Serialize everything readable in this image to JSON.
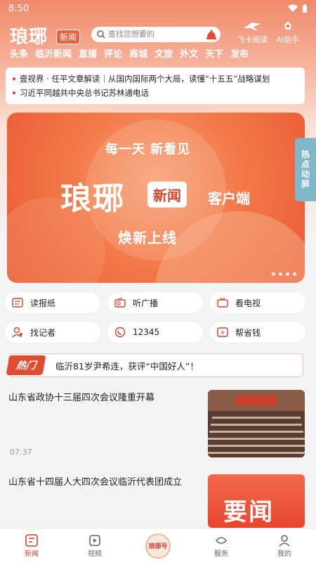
{
  "status": {
    "time": "8:50"
  },
  "header": {
    "logo": "琅琊",
    "logo_badge": "新闻",
    "search_placeholder": "查找您想要的",
    "right_items": [
      {
        "label": "飞卡阅读",
        "icon": "bird-icon"
      },
      {
        "label": "AI助手",
        "icon": "ai-assistant-icon"
      }
    ]
  },
  "channels": [
    "头条",
    "临沂新闻",
    "直播",
    "评论",
    "商城",
    "文旅",
    "外文",
    "天下",
    "发布"
  ],
  "top_news": [
    "壹视界 · 任平文章解读｜从国内国际两个大局，读懂“十五五”战略谋划",
    "习近平同越共中央总书记苏林通电话"
  ],
  "banner": {
    "subtitle": "每一天  新看见",
    "logo": "琅琊",
    "badge": "新闻",
    "client": "客户端",
    "tagline": "焕新上线",
    "dots": 5,
    "active_dot": 0
  },
  "side_float": "热点动屏",
  "services": [
    [
      {
        "label": "读报纸",
        "icon": "newspaper-icon"
      },
      {
        "label": "听广播",
        "icon": "radio-icon"
      },
      {
        "label": "看电视",
        "icon": "tv-icon"
      }
    ],
    [
      {
        "label": "找记者",
        "icon": "reporter-icon"
      },
      {
        "label": "12345",
        "icon": "hotline-icon"
      },
      {
        "label": "帮省钱",
        "icon": "coupon-icon"
      }
    ]
  ],
  "hot": {
    "tag": "热门",
    "text": "临沂81岁尹希连，获评“中国好人”！"
  },
  "articles": [
    {
      "title": "山东省政协十三届四次会议隆重开幕",
      "time": "07:37",
      "image": "meeting-hall-photo"
    },
    {
      "title": "山东省十四届人大四次会议临沂代表团成立",
      "time": "",
      "image": "important-news-graphic",
      "image_text": "要闻"
    }
  ],
  "bottom_nav": [
    {
      "label": "新闻",
      "icon": "news-icon",
      "active": true
    },
    {
      "label": "视频",
      "icon": "video-icon",
      "active": false
    },
    {
      "label": "琅琊号",
      "icon": "langya-center-icon",
      "active": false
    },
    {
      "label": "服务",
      "icon": "service-icon",
      "active": false
    },
    {
      "label": "我的",
      "icon": "profile-icon",
      "active": false
    }
  ],
  "colors": {
    "accent": "#d2442a",
    "banner": "#f37a4a",
    "header": "#f08a6a"
  }
}
